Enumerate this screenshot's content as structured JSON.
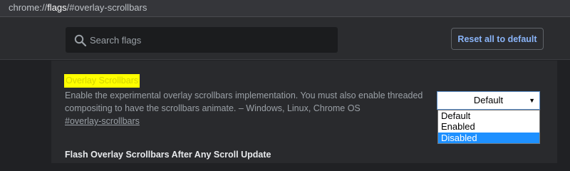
{
  "address_bar": {
    "scheme": "chrome://",
    "host": "flags",
    "path": "/#overlay-scrollbars"
  },
  "header": {
    "search": {
      "placeholder": "Search flags",
      "value": ""
    },
    "reset_label": "Reset all to default"
  },
  "flags": [
    {
      "title": "Overlay Scrollbars",
      "description": "Enable the experimental overlay scrollbars implementation. You must also enable threaded compositing to have the scrollbars animate. – Windows, Linux, Chrome OS",
      "link": "#overlay-scrollbars",
      "select": {
        "value": "Default",
        "options": [
          "Default",
          "Enabled",
          "Disabled"
        ],
        "highlighted": "Disabled"
      }
    },
    {
      "title": "Flash Overlay Scrollbars After Any Scroll Update"
    }
  ],
  "colors": {
    "background": "#202124",
    "header": "#2b2c2f",
    "highlight": "#ffff00",
    "accent": "#8ab4f8",
    "option_highlight": "#1e90ff"
  }
}
